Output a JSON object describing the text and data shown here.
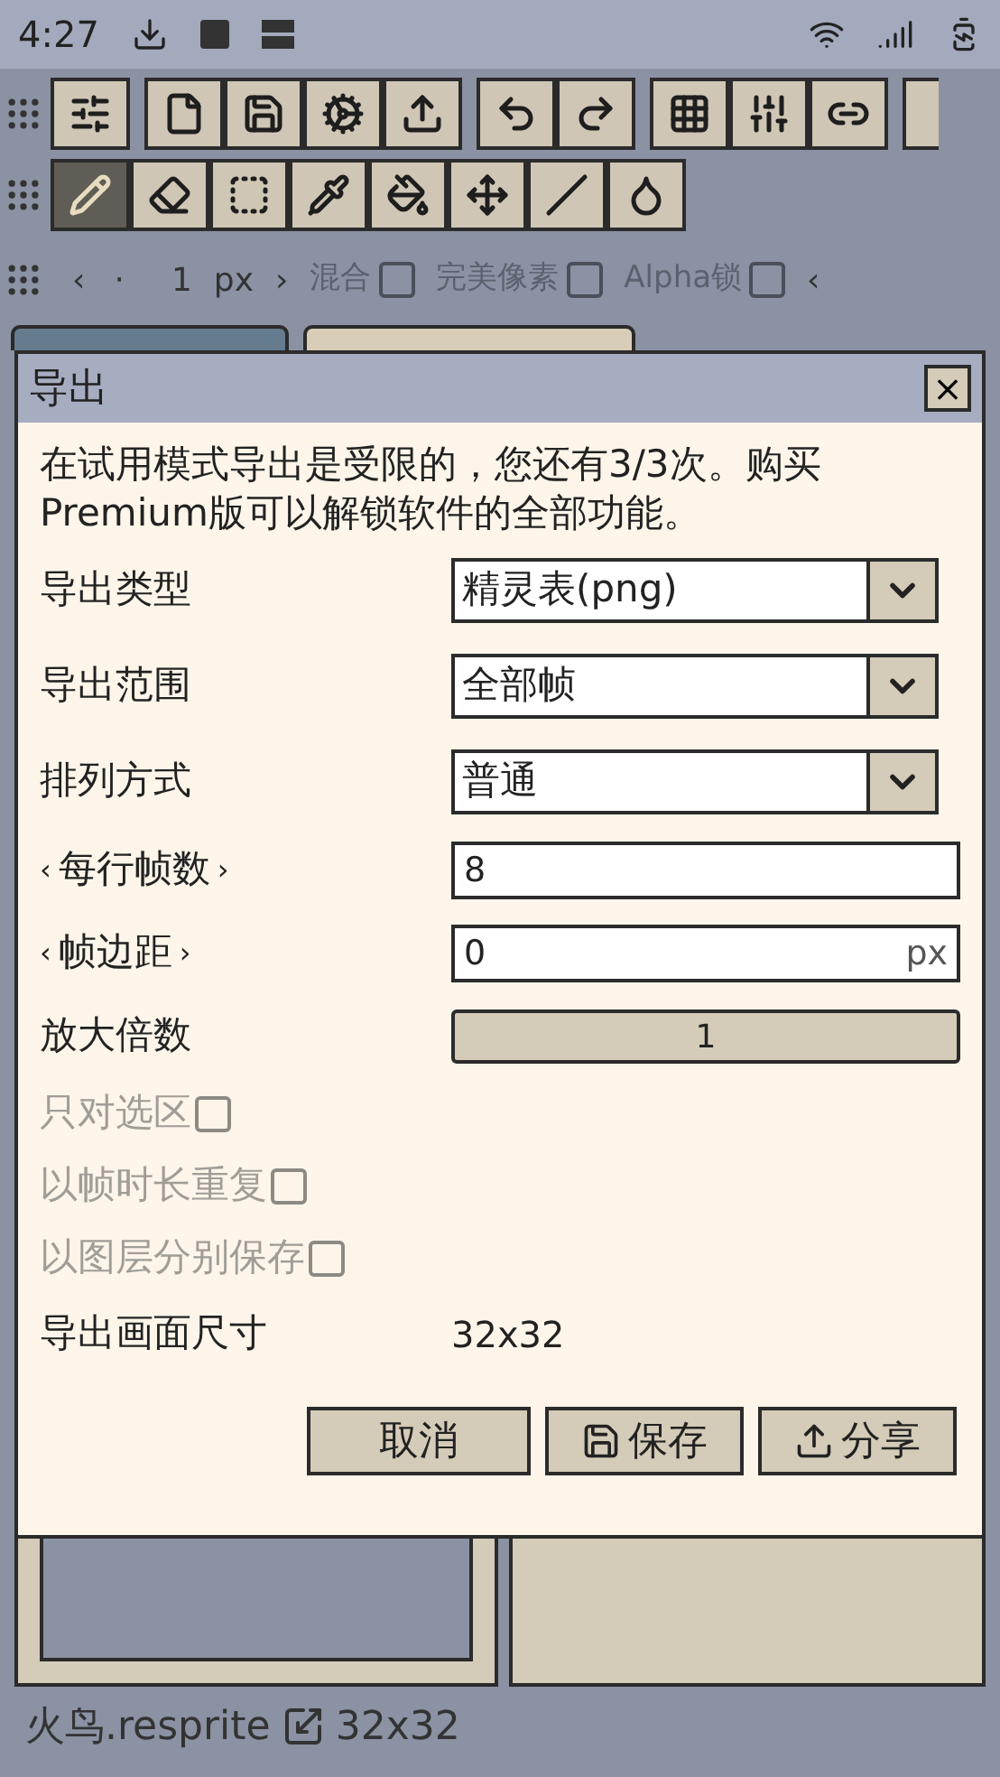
{
  "status_bar": {
    "time": "4:27"
  },
  "toolbar_tools": [
    {
      "selected": true
    },
    {
      "selected": false
    },
    {
      "selected": false
    },
    {
      "selected": false
    },
    {
      "selected": false
    },
    {
      "selected": false
    },
    {
      "selected": false
    },
    {
      "selected": false
    }
  ],
  "brush_bar": {
    "prev": "‹",
    "dot": "·",
    "size": "1",
    "unit": "px",
    "next": "›",
    "options": [
      {
        "label": "混合",
        "checked": false
      },
      {
        "label": "完美像素",
        "checked": false
      },
      {
        "label": "Alpha锁",
        "checked": false
      }
    ],
    "more": "‹"
  },
  "tabs": [
    {
      "selected": true
    },
    {
      "selected": false
    }
  ],
  "dialog": {
    "title": "导出",
    "close": "×",
    "message": "在试用模式导出是受限的，您还有3/3次。购买Premium版可以解锁软件的全部功能。",
    "fields": [
      {
        "kind": "select",
        "label": "导出类型",
        "value": "精灵表(png)"
      },
      {
        "kind": "select",
        "label": "导出范围",
        "value": "全部帧"
      },
      {
        "kind": "select",
        "label": "排列方式",
        "value": "普通"
      },
      {
        "kind": "stepper",
        "prev": "‹",
        "label": "每行帧数",
        "next": "›",
        "value": "8"
      },
      {
        "kind": "stepper",
        "prev": "‹",
        "label": "帧边距",
        "next": "›",
        "value": "0",
        "unit": "px"
      },
      {
        "kind": "button",
        "label": "放大倍数",
        "value": "1"
      },
      {
        "kind": "checkbox",
        "label": "只对选区",
        "checked": false,
        "disabled": true
      },
      {
        "kind": "checkbox",
        "label": "以帧时长重复",
        "checked": false,
        "disabled": true
      },
      {
        "kind": "checkbox",
        "label": "以图层分别保存",
        "checked": false,
        "disabled": true
      },
      {
        "kind": "info",
        "label": "导出画面尺寸",
        "value": "32x32"
      }
    ],
    "buttons": [
      {
        "kind": "cancel",
        "label": "取消"
      },
      {
        "kind": "save",
        "label": "保存"
      },
      {
        "kind": "share",
        "label": "分享"
      }
    ]
  },
  "footer": {
    "file": "火鸟.resprite",
    "size": "32x32"
  }
}
